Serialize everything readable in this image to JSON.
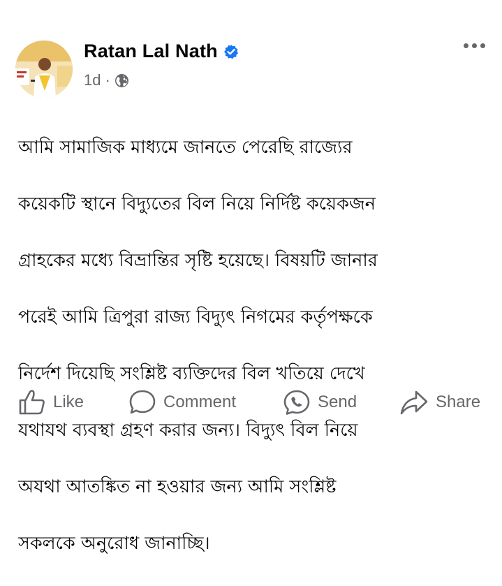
{
  "post": {
    "author": "Ratan Lal Nath",
    "verified": true,
    "timestamp": "1d",
    "separator": "·",
    "audience_icon": "globe-icon",
    "more_icon": "more-options-icon",
    "body": "আমি সামাজিক মাধ্যমে জানতে পেরেছি রাজ্যের কয়েকটি স্থানে বিদ্যুতের বিল নিয়ে নির্দিষ্ট কয়েকজন গ্রাহকের মধ্যে বিভ্রান্তির সৃষ্টি হয়েছে। বিষয়টি জানার পরেই আমি ত্রিপুরা রাজ্য বিদ্যুৎ নিগমের কর্তৃপক্ষকে নির্দেশ দিয়েছি সংশ্লিষ্ট ব্যক্তিদের বিল খতিয়ে দেখে যথাযথ ব্যবস্থা গ্রহণ করার জন্য। বিদ্যুৎ বিল নিয়ে অযথা আতঙ্কিত না হওয়ার জন্য আমি সংশ্লিষ্ট সকলকে অনুরোধ জানাচ্ছি।",
    "body_lines": [
      "আমি সামাজিক মাধ্যমে জানতে পেরেছি রাজ্যের",
      "কয়েকটি স্থানে বিদ্যুতের বিল নিয়ে নির্দিষ্ট কয়েকজন",
      "গ্রাহকের মধ্যে বিভ্রান্তির সৃষ্টি হয়েছে। বিষয়টি জানার",
      "পরেই আমি ত্রিপুরা রাজ্য বিদ্যুৎ নিগমের কর্তৃপক্ষকে",
      "নির্দেশ দিয়েছি সংশ্লিষ্ট ব্যক্তিদের বিল খতিয়ে দেখে",
      "যথাযথ ব্যবস্থা গ্রহণ করার জন্য। বিদ্যুৎ বিল নিয়ে",
      "অযথা আতঙ্কিত না হওয়ার জন্য আমি সংশ্লিষ্ট",
      "সকলকে অনুরোধ জানাচ্ছি।"
    ]
  },
  "actions": [
    {
      "label": "Like",
      "icon": "thumbs-up-icon"
    },
    {
      "label": "Comment",
      "icon": "comment-icon"
    },
    {
      "label": "Send",
      "icon": "messenger-send-icon"
    },
    {
      "label": "Share",
      "icon": "share-arrow-icon"
    }
  ],
  "colors": {
    "text_primary": "#050505",
    "text_secondary": "#65676b",
    "verified_blue": "#1877f2",
    "background": "#ffffff"
  }
}
